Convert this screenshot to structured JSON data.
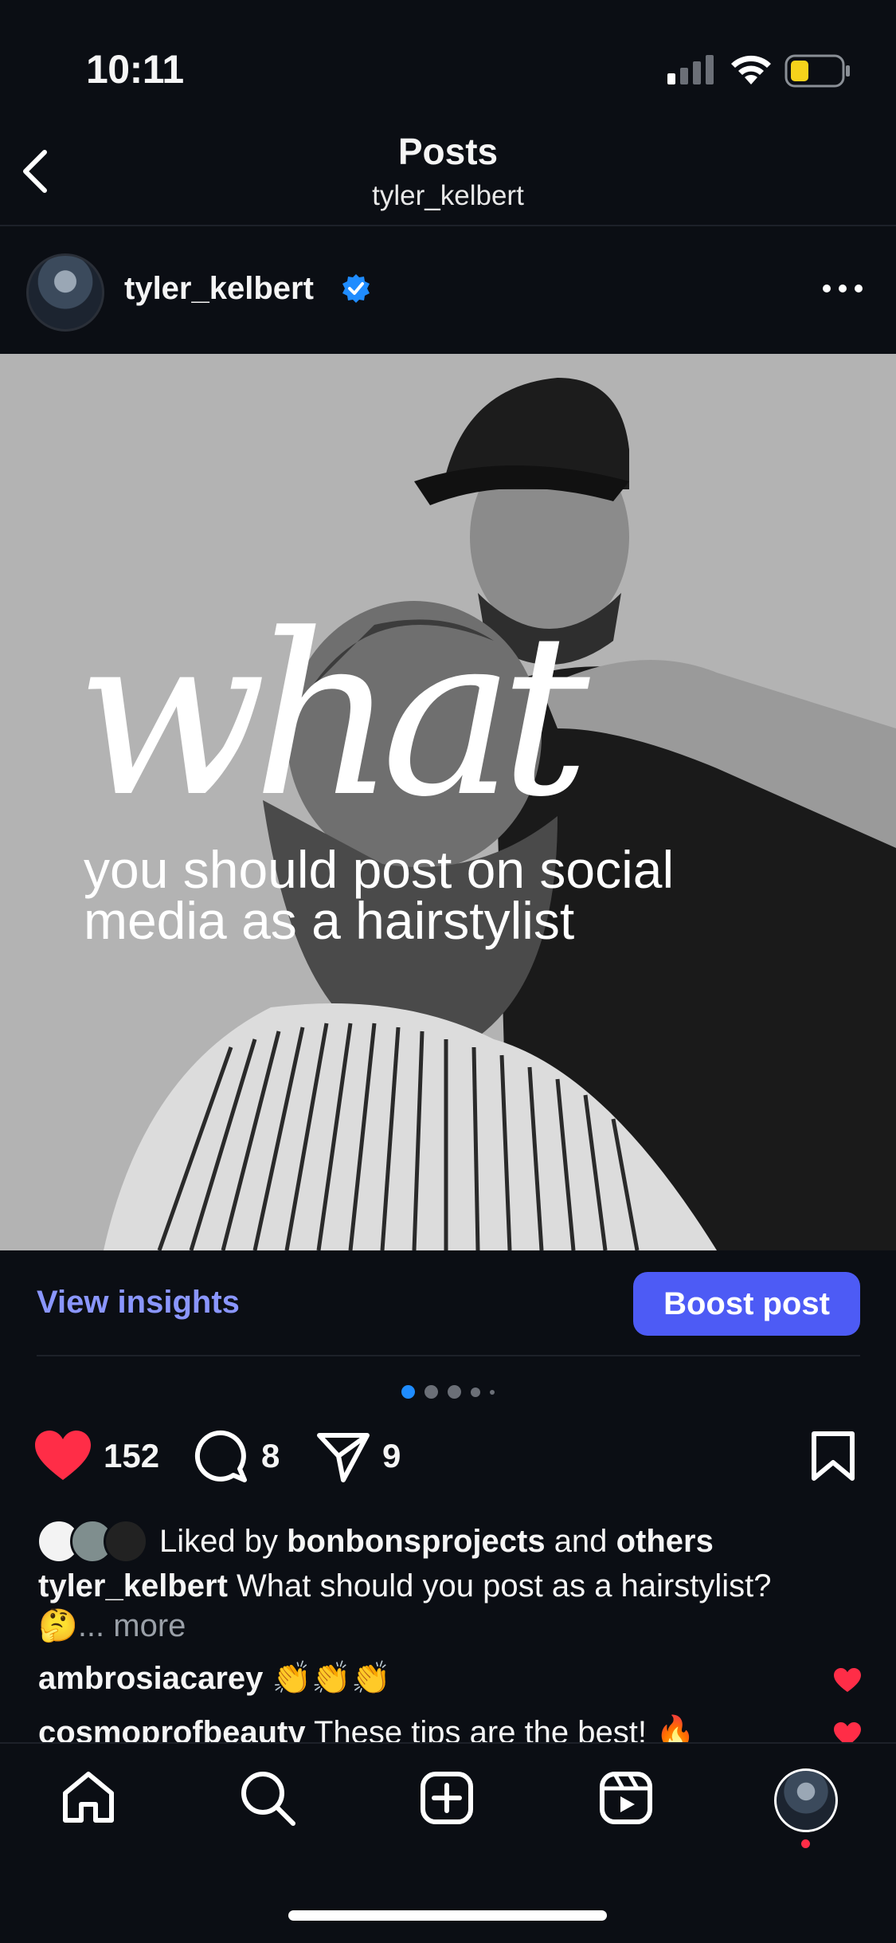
{
  "status_bar": {
    "time": "10:11"
  },
  "header": {
    "title": "Posts",
    "subtitle": "tyler_kelbert"
  },
  "post": {
    "username": "tyler_kelbert",
    "verified": true,
    "image_text": {
      "headline": "what",
      "subline_1": "you should post on social",
      "subline_2": "media as a hairstylist"
    },
    "insights_label": "View insights",
    "boost_label": "Boost post",
    "carousel": {
      "count": 5,
      "active_index": 0
    },
    "counts": {
      "likes": "152",
      "comments": "8",
      "shares": "9"
    },
    "liked_by": {
      "prefix": "Liked by",
      "user": "bonbonsprojects",
      "and": "and",
      "others": "others"
    },
    "caption": {
      "user": "tyler_kelbert",
      "text": "What should you post as a hairstylist?",
      "emoji": "🤔",
      "ellipsis": "...",
      "more": "more"
    },
    "comments": [
      {
        "user": "ambrosiacarey",
        "text": "👏👏👏"
      },
      {
        "user": "cosmoprofbeauty",
        "text": "These tips are the best! 🔥"
      }
    ]
  },
  "colors": {
    "accent": "#4d5bf5",
    "link": "#8a96ff",
    "like": "#ff2d47",
    "verified": "#1f8cff"
  },
  "tabbar": {
    "items": [
      "home-icon",
      "search-icon",
      "create-icon",
      "reels-icon",
      "profile-avatar"
    ]
  }
}
